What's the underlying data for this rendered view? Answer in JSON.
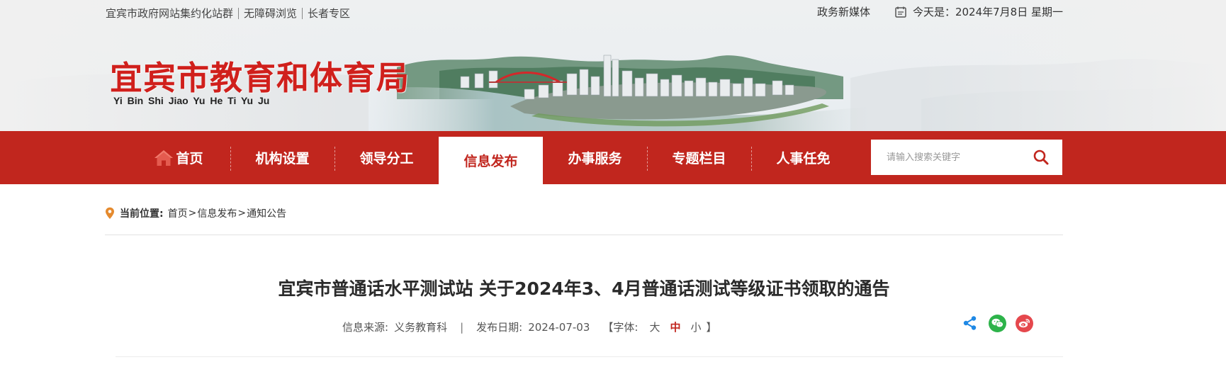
{
  "topbar": {
    "links": [
      "宜宾市政府网站集约化站群",
      "无障碍浏览",
      "长者专区"
    ],
    "media_label": "政务新媒体",
    "date_text": "今天是：2024年7月8日 星期一"
  },
  "site": {
    "title": "宜宾市教育和体育局",
    "pinyin": "Yi Bin Shi Jiao Yu He Ti Yu Ju"
  },
  "nav": {
    "items": [
      {
        "label": "首页",
        "icon": "home-icon"
      },
      {
        "label": "机构设置"
      },
      {
        "label": "领导分工"
      },
      {
        "label": "信息发布",
        "active": true
      },
      {
        "label": "办事服务"
      },
      {
        "label": "专题栏目"
      },
      {
        "label": "人事任免"
      }
    ],
    "search": {
      "placeholder": "请输入搜索关键字",
      "icon": "search-icon"
    }
  },
  "breadcrumb": {
    "label": "当前位置:",
    "items": [
      "首页",
      "信息发布",
      "通知公告"
    ]
  },
  "article": {
    "title": "宜宾市普通话水平测试站 关于2024年3、4月普通话测试等级证书领取的通告",
    "source_label": "信息来源:",
    "source": "义务教育科",
    "date_label": "发布日期:",
    "date": "2024-07-03",
    "font_label": "【字体:",
    "font_sizes": [
      "大",
      "中",
      "小"
    ],
    "font_close": "】",
    "selected_font_size": "中"
  },
  "share": {
    "icons": [
      "share-icon",
      "wechat-icon",
      "weibo-icon"
    ]
  },
  "colors": {
    "brand_red": "#c1261e",
    "title_red": "#d0201c",
    "share_blue": "#1e88e5",
    "wechat_green": "#2db34a",
    "weibo_red": "#e5484d"
  }
}
